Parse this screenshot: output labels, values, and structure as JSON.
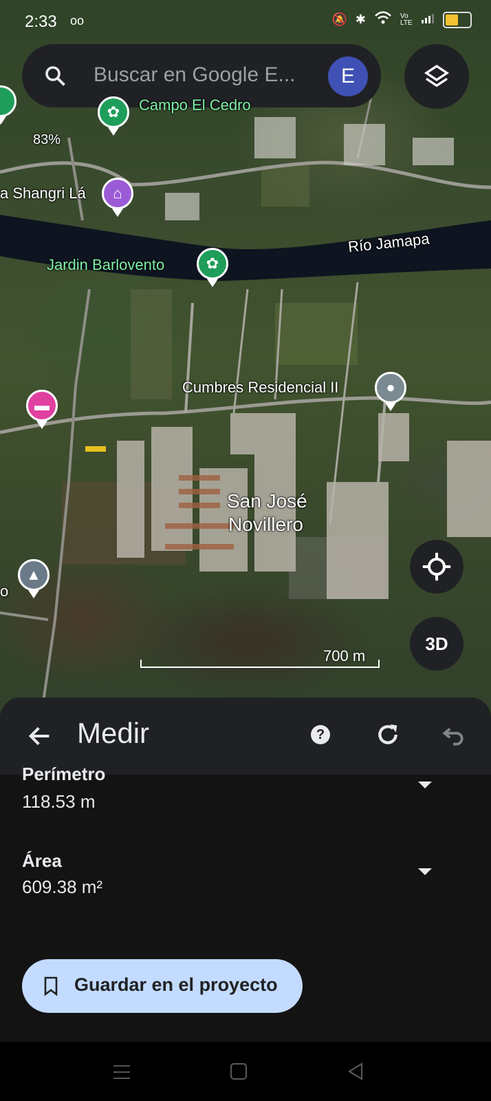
{
  "status_bar": {
    "time": "2:33",
    "voicemail": "oo",
    "battery_level": 0.6,
    "signal_label": "Vo LTE"
  },
  "search": {
    "placeholder": "Buscar en Google E...",
    "avatar_letter": "E"
  },
  "map": {
    "labels": {
      "campo": "Campo El Cedro",
      "percent": "83%",
      "shangri": "a Shangri Lá",
      "rio": "Río Jamapa",
      "jardin": "Jardin Barlovento",
      "cumbres": "Cumbres Residencial II",
      "sanjose_1": "San José",
      "sanjose_2": "Novillero",
      "left_o": "o"
    },
    "scale_label": "700 m",
    "btn_3d": "3D"
  },
  "panel": {
    "title": "Medir",
    "help": "?",
    "perimeter_label": "Perímetro",
    "perimeter_value": "118.53 m",
    "area_label": "Área",
    "area_value": "609.38 m²",
    "save_label": "Guardar en el proyecto"
  },
  "colors": {
    "accent_button": "#c2dbff",
    "avatar": "#3f51b5",
    "panel_bg": "#131313",
    "header_bg": "#202124"
  }
}
